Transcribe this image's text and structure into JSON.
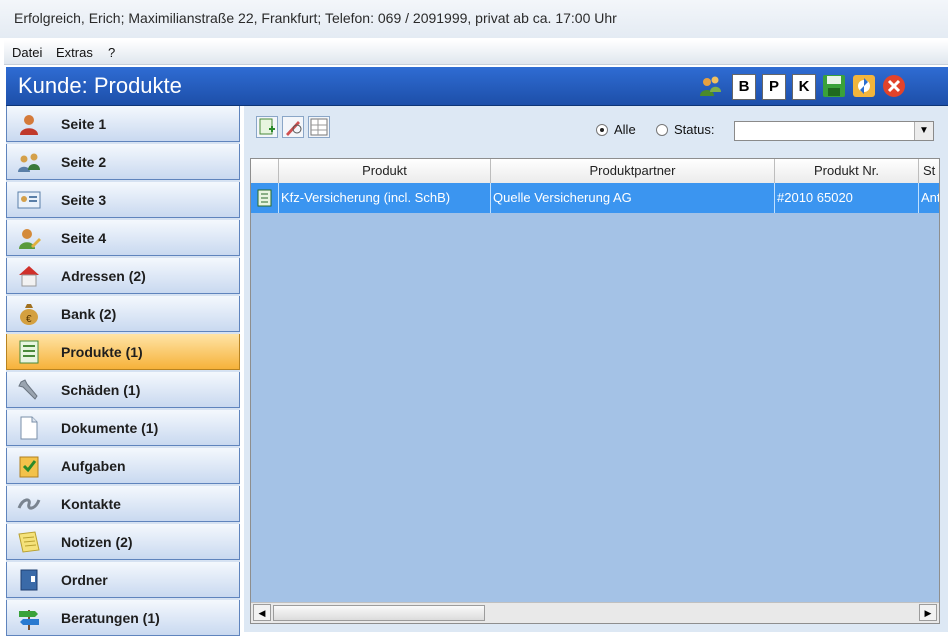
{
  "window": {
    "title": "Erfolgreich, Erich; Maximilianstraße 22, Frankfurt; Telefon: 069 / 2091999, privat ab ca. 17:00 Uhr"
  },
  "menu": {
    "items": [
      "Datei",
      "Extras",
      "?"
    ]
  },
  "header": {
    "title": "Kunde: Produkte",
    "letters": [
      "B",
      "P",
      "K"
    ],
    "icons": [
      "users-icon",
      "save-icon",
      "refresh-icon",
      "close-icon"
    ]
  },
  "sidebar": {
    "items": [
      {
        "label": "Seite 1",
        "icon": "person-orange-icon",
        "active": false
      },
      {
        "label": "Seite 2",
        "icon": "group-icon",
        "active": false
      },
      {
        "label": "Seite 3",
        "icon": "id-card-icon",
        "active": false
      },
      {
        "label": "Seite 4",
        "icon": "person-edit-icon",
        "active": false
      },
      {
        "label": "Adressen (2)",
        "icon": "house-icon",
        "active": false
      },
      {
        "label": "Bank (2)",
        "icon": "money-bag-icon",
        "active": false
      },
      {
        "label": "Produkte (1)",
        "icon": "document-list-icon",
        "active": true
      },
      {
        "label": "Schäden (1)",
        "icon": "wrench-icon",
        "active": false
      },
      {
        "label": "Dokumente (1)",
        "icon": "document-icon",
        "active": false
      },
      {
        "label": "Aufgaben",
        "icon": "task-check-icon",
        "active": false
      },
      {
        "label": "Kontakte",
        "icon": "handshake-icon",
        "active": false
      },
      {
        "label": "Notizen (2)",
        "icon": "notes-icon",
        "active": false
      },
      {
        "label": "Ordner",
        "icon": "folder-icon",
        "active": false
      },
      {
        "label": "Beratungen (1)",
        "icon": "signpost-icon",
        "active": false
      }
    ]
  },
  "filter": {
    "alle": "Alle",
    "status": "Status:",
    "status_value": ""
  },
  "grid": {
    "columns": [
      "",
      "Produkt",
      "Produktpartner",
      "Produkt Nr.",
      "St"
    ],
    "rows": [
      {
        "produkt": "Kfz-Versicherung (incl. SchB)",
        "partner": "Quelle Versicherung AG",
        "nr": "#2010 65020",
        "status": "Ant"
      }
    ]
  },
  "colors": {
    "header": "#2563c5",
    "active": "#f6b23a",
    "row_selected": "#3b95f0",
    "grid_bg": "#a4c2e6"
  }
}
